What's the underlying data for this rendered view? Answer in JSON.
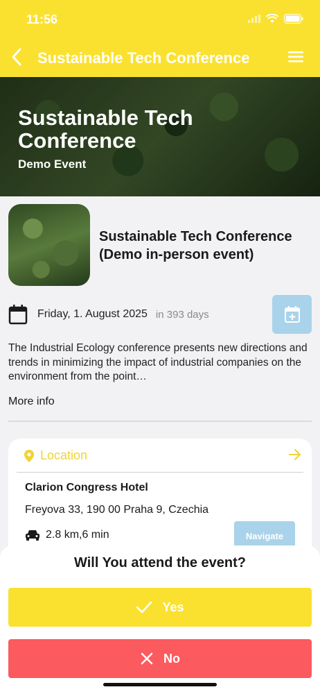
{
  "status_bar": {
    "time": "11:56"
  },
  "nav": {
    "title": "Sustainable Tech Conference",
    "back_icon": "chevron-left-icon",
    "menu_icon": "hamburger-menu-icon"
  },
  "hero": {
    "title": "Sustainable Tech Conference",
    "subtitle": "Demo Event"
  },
  "event": {
    "name": "Sustainable Tech Conference (Demo in-person event)",
    "date": "Friday, 1. August 2025",
    "relative": "in 393 days",
    "description": "The Industrial Ecology conference presents new directions and trends in minimizing the impact of industrial companies on the environment from the point…",
    "more_info": "More info"
  },
  "location": {
    "label": "Location",
    "venue": "Clarion Congress Hotel",
    "address": "Freyova 33, 190 00 Praha 9, Czechia",
    "distance": "2.8 km,6 min",
    "navigate_label": "Navigate"
  },
  "rsvp": {
    "question": "Will You attend the event?",
    "yes_label": "Yes",
    "no_label": "No"
  },
  "colors": {
    "accent_yellow": "#fbe12f",
    "accent_blue_light": "#a9d3ea",
    "decline_red": "#fb5a5f",
    "location_yellow": "#f0d334"
  }
}
